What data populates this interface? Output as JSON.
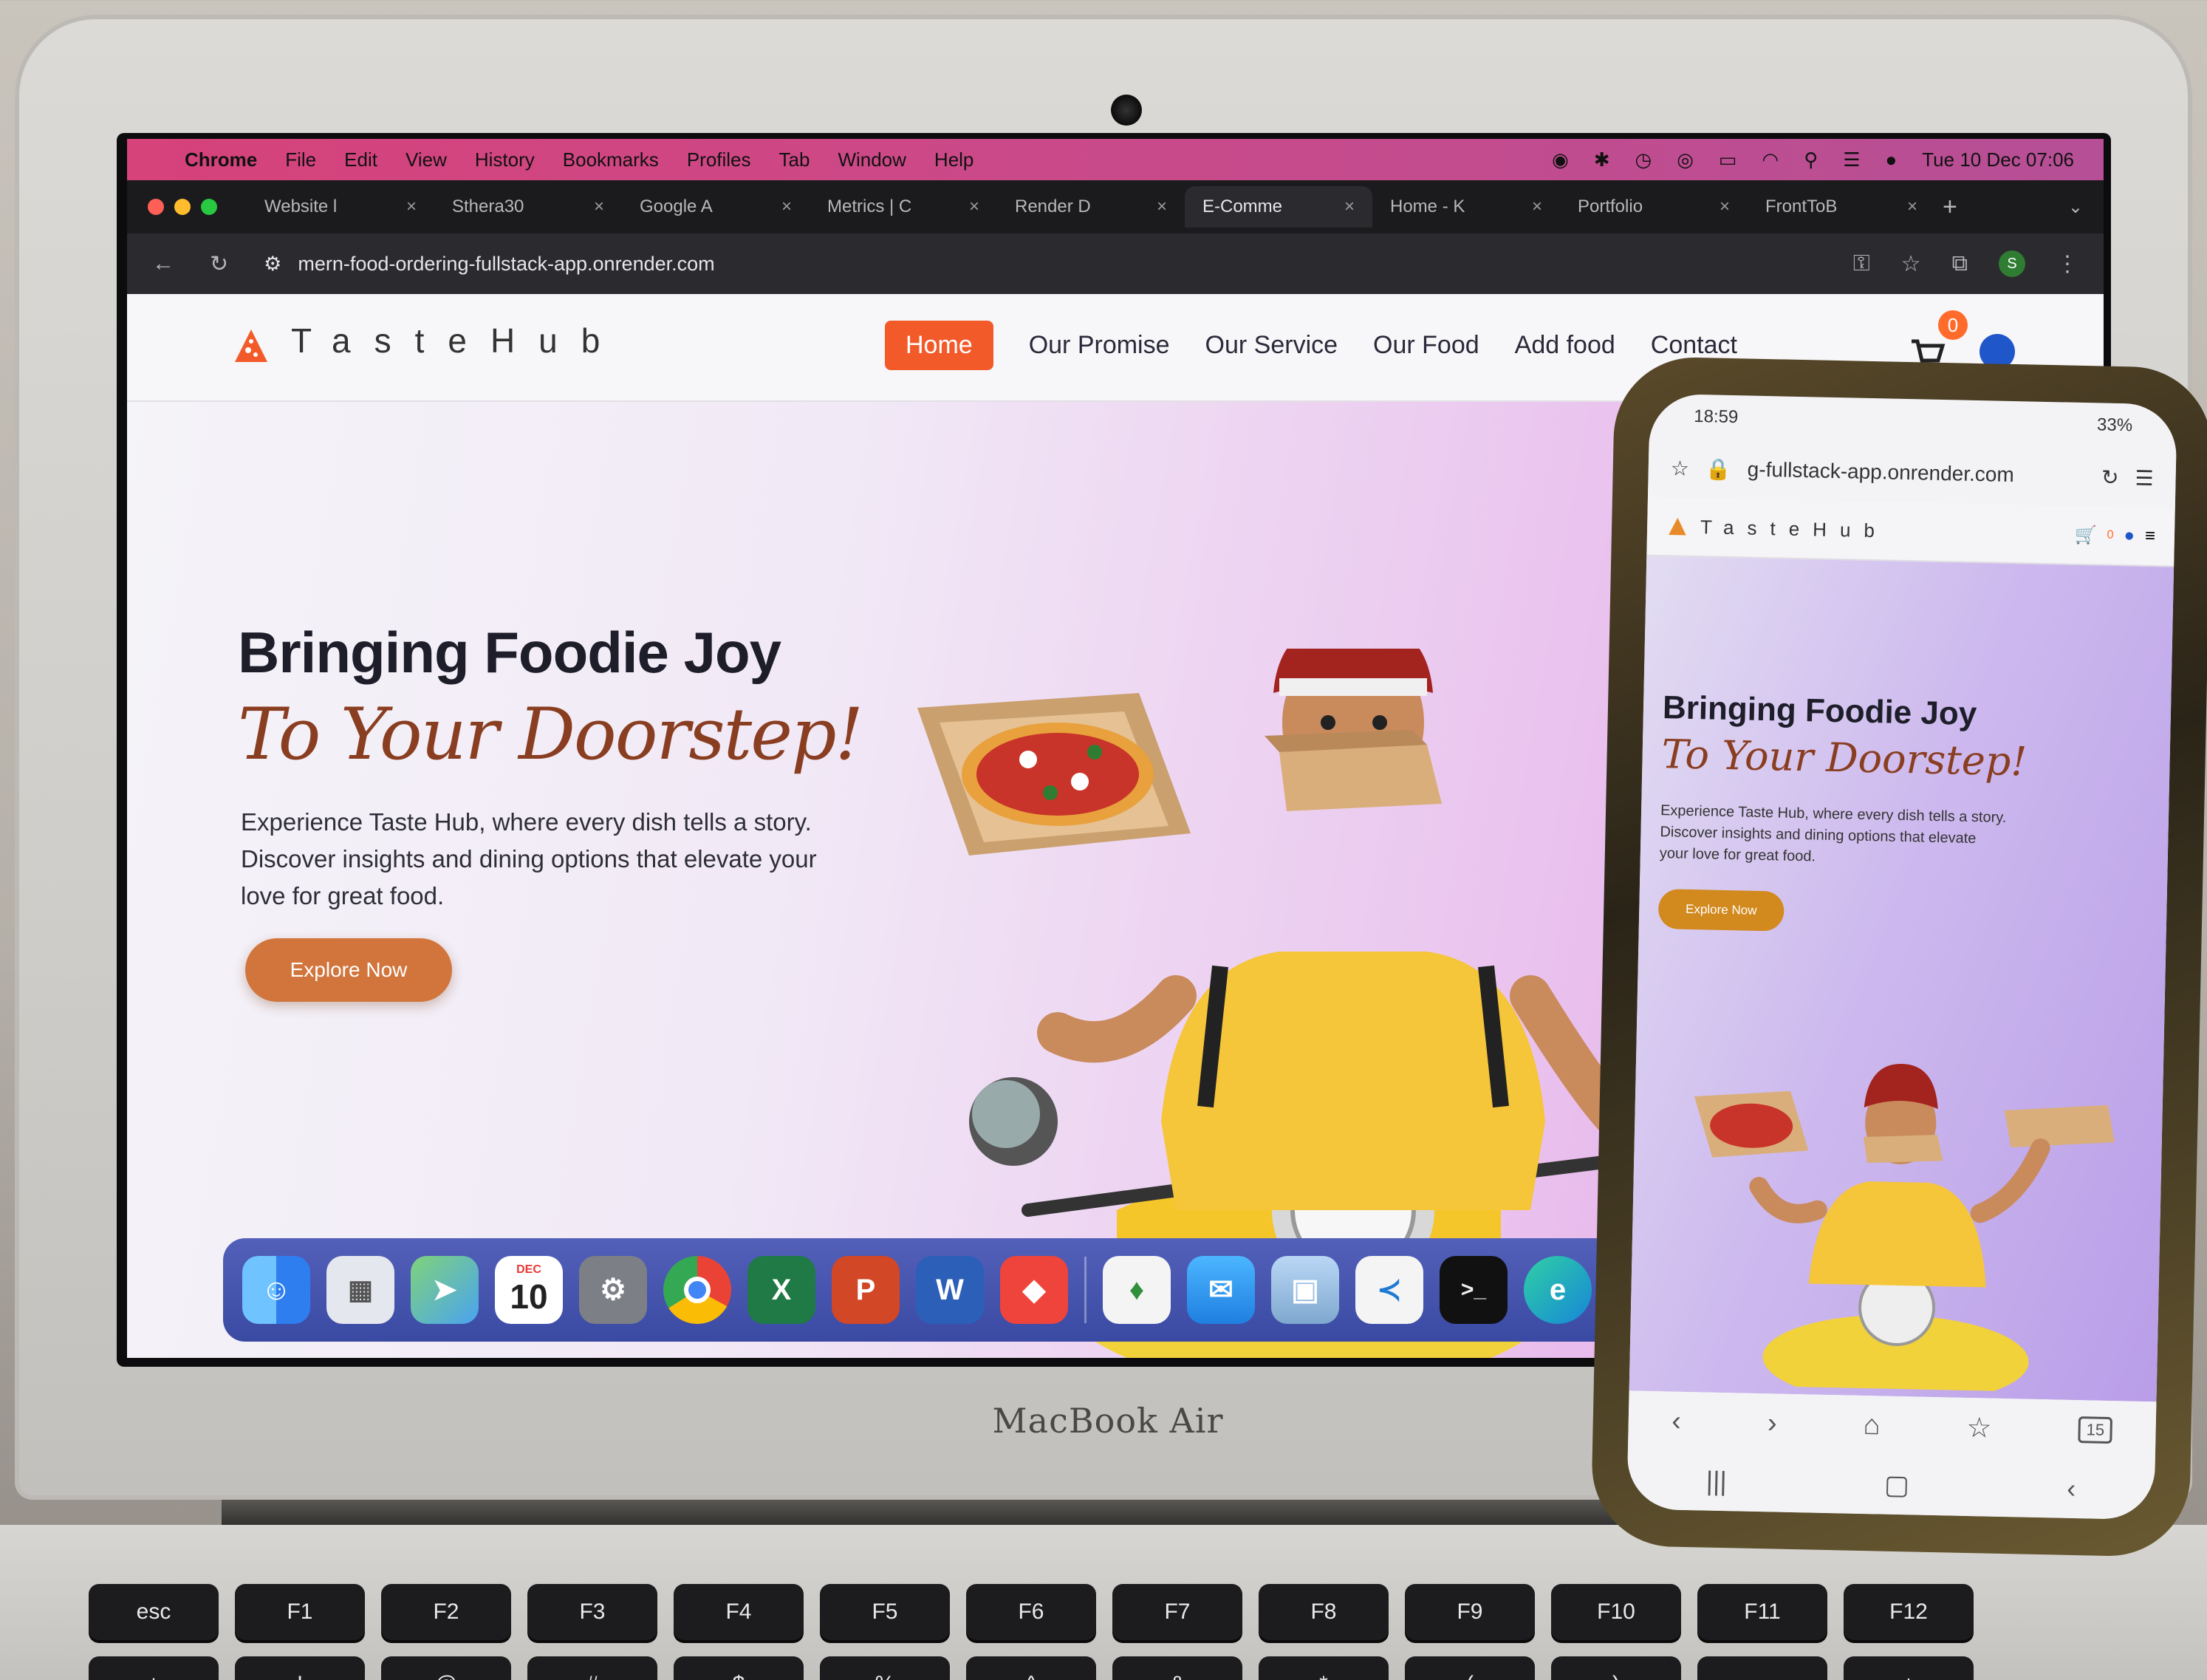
{
  "menubar": {
    "app": "Chrome",
    "items": [
      "File",
      "Edit",
      "View",
      "History",
      "Bookmarks",
      "Profiles",
      "Tab",
      "Window",
      "Help"
    ],
    "datetime": "Tue 10 Dec 07:06"
  },
  "tabs": [
    {
      "label": "Website l",
      "active": false
    },
    {
      "label": "Sthera30",
      "active": false
    },
    {
      "label": "Google A",
      "active": false
    },
    {
      "label": "Metrics | C",
      "active": false
    },
    {
      "label": "Render D",
      "active": false
    },
    {
      "label": "E-Comme",
      "active": true
    },
    {
      "label": "Home - K",
      "active": false
    },
    {
      "label": "Portfolio",
      "active": false
    },
    {
      "label": "FrontToB",
      "active": false
    }
  ],
  "toolbar": {
    "url": "mern-food-ordering-fullstack-app.onrender.com",
    "profile_initial": "S"
  },
  "site": {
    "logo": "TasteHub",
    "nav": [
      "Home",
      "Our Promise",
      "Our Service",
      "Our Food",
      "Add food",
      "Contact"
    ],
    "cart_count": "0",
    "hero_title": "Bringing Foodie Joy",
    "hero_title2": "To Your Doorstep!",
    "hero_desc": "Experience Taste Hub, where every dish tells a story. Discover insights and dining options that elevate your love for great food.",
    "cta": "Explore Now"
  },
  "dock": {
    "calendar_month": "DEC",
    "calendar_day": "10",
    "apps": [
      "finder-icon",
      "launchpad-icon",
      "maps-icon",
      "calendar-icon",
      "settings-icon",
      "chrome-icon",
      "excel-icon",
      "powerpoint-icon",
      "word-icon",
      "anydesk-icon",
      "mongodb-icon",
      "mail-icon",
      "preview-icon",
      "vscode-icon",
      "terminal-icon",
      "edge-icon"
    ]
  },
  "laptop": {
    "brand": "MacBook Air",
    "keys_top": [
      "esc",
      "F1",
      "F2",
      "F3",
      "F4",
      "F5",
      "F6",
      "F7",
      "F8",
      "F9",
      "F10",
      "F11",
      "F12",
      "⏻"
    ],
    "keys_bottom": [
      "±",
      "!",
      "@",
      "#",
      "$",
      "%",
      "^",
      "&",
      "*",
      "(",
      ")",
      "–",
      "+"
    ]
  },
  "phone": {
    "time": "18:59",
    "battery": "33%",
    "url": "g-fullstack-app.onrender.com",
    "logo": "TasteHub",
    "cart_count": "0",
    "hero_title": "Bringing Foodie Joy",
    "hero_title2": "To Your Doorstep!",
    "hero_desc": "Experience Taste Hub, where every dish tells a story. Discover insights and dining options that elevate your love for great food.",
    "cta": "Explore Now",
    "tab_count": "15"
  },
  "colors": {
    "menubar": "#d6427a",
    "nav_active": "#f35a2a",
    "cta": "#d2753c",
    "title_accent": "#8a3e21"
  }
}
